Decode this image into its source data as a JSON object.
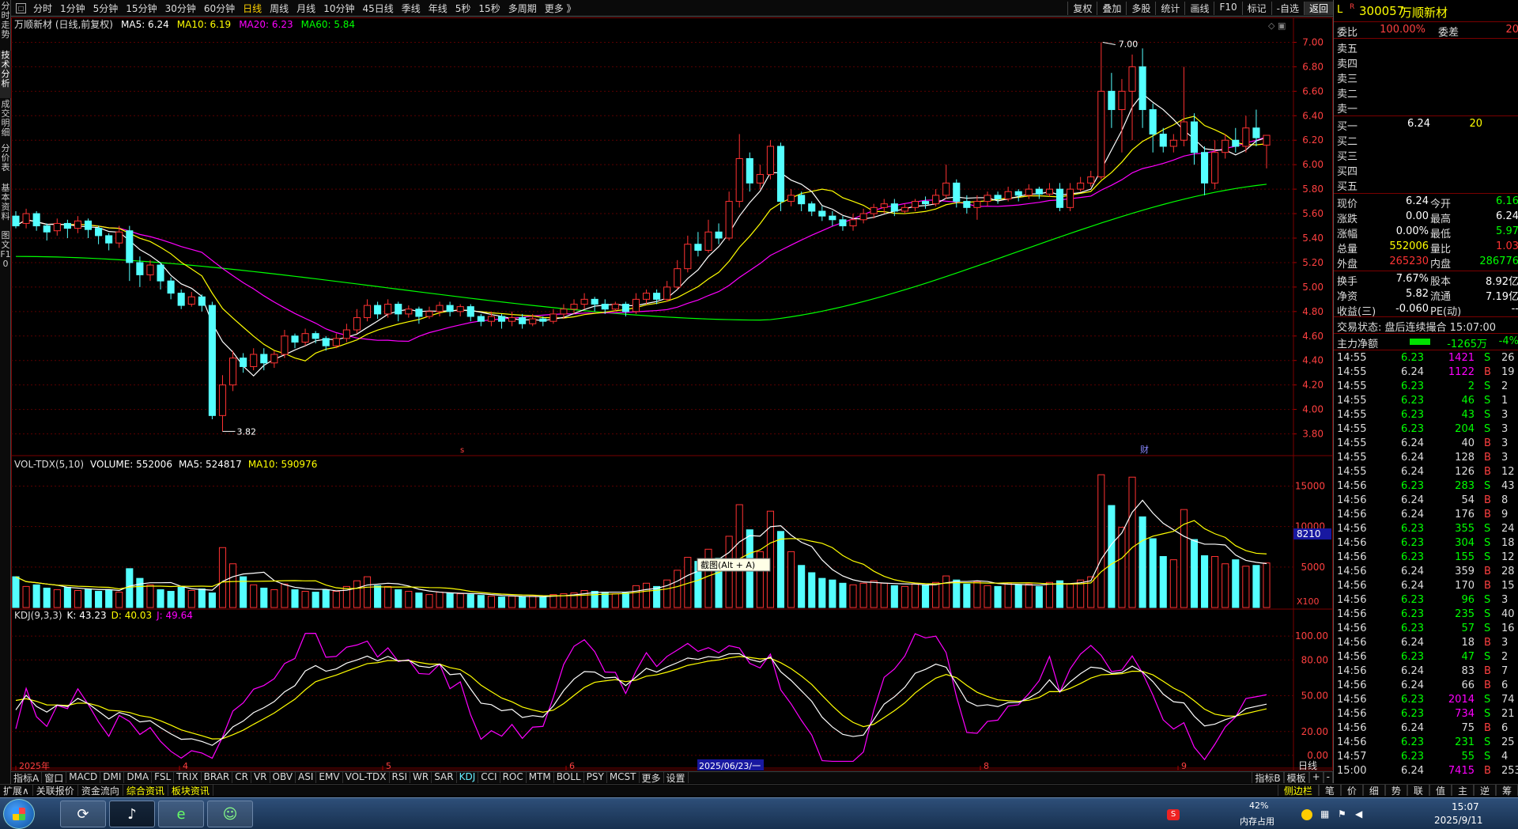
{
  "toolbar": {
    "periods": [
      "分时",
      "1分钟",
      "5分钟",
      "15分钟",
      "30分钟",
      "60分钟",
      "日线",
      "周线",
      "月线",
      "10分钟",
      "45日线",
      "季线",
      "年线",
      "5秒",
      "15秒",
      "多周期",
      "更多 》"
    ],
    "active_period": "日线",
    "right_buttons": [
      "复权",
      "叠加",
      "多股",
      "统计",
      "画线",
      "F10",
      "标记",
      "-自选",
      "返回"
    ],
    "active_right": "返回"
  },
  "side_tabs": [
    "分时走势",
    "技术分析",
    "成交明细",
    "分价表",
    "基本资料",
    "图文F10"
  ],
  "main": {
    "title": "万顺新材 (日线,前复权)",
    "ma": [
      {
        "label": "MA5: 6.24",
        "color": "#ffffff"
      },
      {
        "label": "MA10: 6.19",
        "color": "#ffff00"
      },
      {
        "label": "MA20: 6.23",
        "color": "#ff00ff"
      },
      {
        "label": "MA60: 5.84",
        "color": "#00ff00"
      }
    ],
    "y_ticks": [
      "7.00",
      "6.80",
      "6.60",
      "6.40",
      "6.20",
      "6.00",
      "5.80",
      "5.60",
      "5.40",
      "5.20",
      "5.00",
      "4.80",
      "4.60",
      "4.40",
      "4.20",
      "4.00",
      "3.80"
    ],
    "high_label": "7.00",
    "low_label": "3.82",
    "marker_s": "s",
    "marker_cai": "财"
  },
  "volume": {
    "title": "VOL-TDX(5,10)",
    "vol": "VOLUME: 552006",
    "ma5": "MA5: 524817",
    "ma10": "MA10: 590976",
    "y_ticks": [
      "15000",
      "10000",
      "5000"
    ],
    "badge": "8210",
    "unit": "X100"
  },
  "kdj": {
    "title": "KDJ(9,3,3)",
    "k": "K: 43.23",
    "d": "D: 40.03",
    "j": "J: 49.64",
    "y_ticks": [
      "100.00",
      "80.00",
      "50.00",
      "20.00",
      "0.00"
    ]
  },
  "x_axis": {
    "labels": [
      "2025年",
      "4",
      "5",
      "6",
      "8",
      "9"
    ],
    "cursor_date": "2025/06/23/一",
    "right": "日线"
  },
  "tooltip": "截图(Alt + A)",
  "indicator_tabs": [
    "指标A",
    "窗口",
    "MACD",
    "DMI",
    "DMA",
    "FSL",
    "TRIX",
    "BRAR",
    "CR",
    "VR",
    "OBV",
    "ASI",
    "EMV",
    "VOL-TDX",
    "RSI",
    "WR",
    "SAR",
    "KDJ",
    "CCI",
    "ROC",
    "MTM",
    "BOLL",
    "PSY",
    "MCST",
    "更多",
    "设置"
  ],
  "active_indicator": "KDJ",
  "indicator_right": [
    "指标B",
    "模板",
    "+",
    "-"
  ],
  "bottom_tabs": [
    "扩展∧",
    "关联报价",
    "资金流向",
    "综合资讯",
    "板块资讯"
  ],
  "bottom_right": [
    "侧边栏",
    "笔",
    "价",
    "细",
    "势",
    "联",
    "值",
    "主",
    "逆",
    "筹"
  ],
  "stock": {
    "code": "300057",
    "name": "万顺新材",
    "prefix": "L",
    "superscript": "R",
    "weibi_label": "委比",
    "weibi": "100.00%",
    "weicha_label": "委差",
    "weicha": "20",
    "sells": [
      "卖五",
      "卖四",
      "卖三",
      "卖二",
      "卖一"
    ],
    "buys": [
      {
        "l": "买一",
        "p": "6.24",
        "v": "20"
      },
      {
        "l": "买二",
        "p": "",
        "v": ""
      },
      {
        "l": "买三",
        "p": "",
        "v": ""
      },
      {
        "l": "买四",
        "p": "",
        "v": ""
      },
      {
        "l": "买五",
        "p": "",
        "v": ""
      }
    ],
    "quote": [
      {
        "l": "现价",
        "v": "6.24",
        "vc": "#ffffff",
        "l2": "今开",
        "v2": "6.16",
        "v2c": "#00ff00"
      },
      {
        "l": "涨跌",
        "v": "0.00",
        "vc": "#ffffff",
        "l2": "最高",
        "v2": "6.24",
        "v2c": "#ffffff"
      },
      {
        "l": "涨幅",
        "v": "0.00%",
        "vc": "#ffffff",
        "l2": "最低",
        "v2": "5.97",
        "v2c": "#00ff00"
      },
      {
        "l": "总量",
        "v": "552006",
        "vc": "#ffff00",
        "l2": "量比",
        "v2": "1.03",
        "v2c": "#ff3333"
      },
      {
        "l": "外盘",
        "v": "265230",
        "vc": "#ff3333",
        "l2": "内盘",
        "v2": "286776",
        "v2c": "#00ff00"
      }
    ],
    "fund": [
      {
        "l": "换手",
        "v": "7.67%",
        "l2": "股本",
        "v2": "8.92亿"
      },
      {
        "l": "净资",
        "v": "5.82",
        "l2": "流通",
        "v2": "7.19亿"
      },
      {
        "l": "收益(三)",
        "v": "-0.060",
        "l2": "PE(动)",
        "v2": "--"
      }
    ],
    "status": "交易状态: 盘后连续撮合 15:07:00",
    "flow_label": "主力净额",
    "flow_value": "-1265万",
    "flow_pct": "-4%"
  },
  "ticks": [
    [
      "14:55",
      "6.23",
      "1421",
      "S",
      "26"
    ],
    [
      "14:55",
      "6.24",
      "1122",
      "B",
      "19"
    ],
    [
      "14:55",
      "6.23",
      "2",
      "S",
      "2"
    ],
    [
      "14:55",
      "6.23",
      "46",
      "S",
      "1"
    ],
    [
      "14:55",
      "6.23",
      "43",
      "S",
      "3"
    ],
    [
      "14:55",
      "6.23",
      "204",
      "S",
      "3"
    ],
    [
      "14:55",
      "6.24",
      "40",
      "B",
      "3"
    ],
    [
      "14:55",
      "6.24",
      "128",
      "B",
      "3"
    ],
    [
      "14:55",
      "6.24",
      "126",
      "B",
      "12"
    ],
    [
      "14:56",
      "6.23",
      "283",
      "S",
      "43"
    ],
    [
      "14:56",
      "6.24",
      "54",
      "B",
      "8"
    ],
    [
      "14:56",
      "6.24",
      "176",
      "B",
      "9"
    ],
    [
      "14:56",
      "6.23",
      "355",
      "S",
      "24"
    ],
    [
      "14:56",
      "6.23",
      "304",
      "S",
      "18"
    ],
    [
      "14:56",
      "6.23",
      "155",
      "S",
      "12"
    ],
    [
      "14:56",
      "6.24",
      "359",
      "B",
      "28"
    ],
    [
      "14:56",
      "6.24",
      "170",
      "B",
      "15"
    ],
    [
      "14:56",
      "6.23",
      "96",
      "S",
      "3"
    ],
    [
      "14:56",
      "6.23",
      "235",
      "S",
      "40"
    ],
    [
      "14:56",
      "6.23",
      "57",
      "S",
      "16"
    ],
    [
      "14:56",
      "6.24",
      "18",
      "B",
      "3"
    ],
    [
      "14:56",
      "6.23",
      "47",
      "S",
      "2"
    ],
    [
      "14:56",
      "6.24",
      "83",
      "B",
      "7"
    ],
    [
      "14:56",
      "6.24",
      "66",
      "B",
      "6"
    ],
    [
      "14:56",
      "6.23",
      "2014",
      "S",
      "74"
    ],
    [
      "14:56",
      "6.23",
      "734",
      "S",
      "21"
    ],
    [
      "14:56",
      "6.24",
      "75",
      "B",
      "6"
    ],
    [
      "14:56",
      "6.23",
      "231",
      "S",
      "25"
    ],
    [
      "14:57",
      "6.23",
      "55",
      "S",
      "4"
    ],
    [
      "15:00",
      "6.24",
      "7415",
      "B",
      "253"
    ]
  ],
  "taskbar": {
    "mem_pct": "42%",
    "mem_label": "内存占用",
    "time": "15:07",
    "date": "2025/9/11"
  },
  "colors": {
    "up": "#ff3232",
    "down": "#54ffff",
    "ma5": "#ffffff",
    "ma10": "#ffff00",
    "ma20": "#ff00ff",
    "ma60": "#00ff00"
  },
  "chart_data": {
    "type": "candlestick",
    "candles": [
      [
        5.58,
        5.5,
        5.62,
        5.48
      ],
      [
        5.52,
        5.6,
        5.64,
        5.48
      ],
      [
        5.6,
        5.5,
        5.62,
        5.46
      ],
      [
        5.5,
        5.45,
        5.52,
        5.38
      ],
      [
        5.46,
        5.52,
        5.56,
        5.42
      ],
      [
        5.52,
        5.48,
        5.55,
        5.4
      ],
      [
        5.48,
        5.54,
        5.58,
        5.44
      ],
      [
        5.54,
        5.47,
        5.56,
        5.4
      ],
      [
        5.48,
        5.42,
        5.5,
        5.35
      ],
      [
        5.42,
        5.36,
        5.44,
        5.3
      ],
      [
        5.36,
        5.45,
        5.5,
        5.32
      ],
      [
        5.46,
        5.2,
        5.5,
        5.05
      ],
      [
        5.2,
        5.1,
        5.25,
        5.0
      ],
      [
        5.1,
        5.18,
        5.22,
        5.05
      ],
      [
        5.18,
        5.05,
        5.2,
        4.98
      ],
      [
        5.05,
        4.95,
        5.08,
        4.9
      ],
      [
        4.95,
        4.85,
        4.98,
        4.82
      ],
      [
        4.86,
        4.92,
        4.96,
        4.84
      ],
      [
        4.92,
        4.85,
        4.94,
        4.8
      ],
      [
        4.85,
        3.95,
        4.88,
        3.92
      ],
      [
        3.95,
        4.2,
        4.28,
        3.82
      ],
      [
        4.2,
        4.42,
        4.48,
        4.15
      ],
      [
        4.42,
        4.35,
        4.46,
        4.3
      ],
      [
        4.35,
        4.45,
        4.5,
        4.32
      ],
      [
        4.45,
        4.38,
        4.5,
        4.32
      ],
      [
        4.38,
        4.45,
        4.48,
        4.34
      ],
      [
        4.45,
        4.6,
        4.65,
        4.42
      ],
      [
        4.6,
        4.55,
        4.62,
        4.5
      ],
      [
        4.55,
        4.62,
        4.66,
        4.52
      ],
      [
        4.62,
        4.58,
        4.64,
        4.54
      ],
      [
        4.58,
        4.52,
        4.6,
        4.48
      ],
      [
        4.52,
        4.58,
        4.62,
        4.5
      ],
      [
        4.58,
        4.65,
        4.7,
        4.55
      ],
      [
        4.65,
        4.75,
        4.82,
        4.62
      ],
      [
        4.75,
        4.85,
        4.9,
        4.72
      ],
      [
        4.85,
        4.78,
        4.88,
        4.74
      ],
      [
        4.78,
        4.86,
        4.9,
        4.75
      ],
      [
        4.86,
        4.78,
        4.88,
        4.72
      ],
      [
        4.78,
        4.82,
        4.85,
        4.75
      ],
      [
        4.82,
        4.76,
        4.84,
        4.7
      ],
      [
        4.76,
        4.8,
        4.84,
        4.74
      ],
      [
        4.8,
        4.85,
        4.88,
        4.76
      ],
      [
        4.85,
        4.8,
        4.88,
        4.76
      ],
      [
        4.8,
        4.84,
        4.86,
        4.76
      ],
      [
        4.84,
        4.76,
        4.86,
        4.72
      ],
      [
        4.76,
        4.72,
        4.78,
        4.68
      ],
      [
        4.72,
        4.76,
        4.8,
        4.68
      ],
      [
        4.76,
        4.72,
        4.78,
        4.66
      ],
      [
        4.72,
        4.75,
        4.8,
        4.68
      ],
      [
        4.75,
        4.7,
        4.78,
        4.66
      ],
      [
        4.7,
        4.74,
        4.78,
        4.68
      ],
      [
        4.74,
        4.72,
        4.76,
        4.68
      ],
      [
        4.72,
        4.78,
        4.82,
        4.7
      ],
      [
        4.78,
        4.82,
        4.86,
        4.74
      ],
      [
        4.82,
        4.86,
        4.9,
        4.78
      ],
      [
        4.86,
        4.9,
        4.95,
        4.82
      ],
      [
        4.9,
        4.86,
        4.92,
        4.8
      ],
      [
        4.86,
        4.82,
        4.9,
        4.78
      ],
      [
        4.82,
        4.86,
        4.88,
        4.8
      ],
      [
        4.86,
        4.8,
        4.88,
        4.76
      ],
      [
        4.8,
        4.9,
        4.95,
        4.78
      ],
      [
        4.9,
        4.95,
        4.98,
        4.86
      ],
      [
        4.95,
        4.9,
        4.98,
        4.86
      ],
      [
        4.9,
        5.0,
        5.05,
        4.88
      ],
      [
        5.0,
        5.15,
        5.22,
        4.98
      ],
      [
        5.15,
        5.35,
        5.42,
        5.12
      ],
      [
        5.35,
        5.3,
        5.45,
        5.25
      ],
      [
        5.3,
        5.45,
        5.55,
        5.28
      ],
      [
        5.45,
        5.4,
        5.52,
        5.35
      ],
      [
        5.4,
        5.7,
        5.78,
        5.38
      ],
      [
        5.7,
        6.05,
        6.25,
        5.65
      ],
      [
        6.05,
        5.85,
        6.1,
        5.78
      ],
      [
        5.85,
        5.92,
        6.0,
        5.8
      ],
      [
        5.92,
        6.15,
        6.2,
        5.88
      ],
      [
        6.15,
        5.7,
        6.18,
        5.62
      ],
      [
        5.7,
        5.75,
        5.8,
        5.66
      ],
      [
        5.75,
        5.68,
        5.78,
        5.62
      ],
      [
        5.68,
        5.62,
        5.7,
        5.58
      ],
      [
        5.62,
        5.58,
        5.66,
        5.54
      ],
      [
        5.58,
        5.55,
        5.62,
        5.5
      ],
      [
        5.55,
        5.5,
        5.58,
        5.46
      ],
      [
        5.5,
        5.55,
        5.6,
        5.46
      ],
      [
        5.55,
        5.6,
        5.64,
        5.52
      ],
      [
        5.6,
        5.65,
        5.68,
        5.56
      ],
      [
        5.65,
        5.68,
        5.72,
        5.6
      ],
      [
        5.68,
        5.62,
        5.72,
        5.58
      ],
      [
        5.62,
        5.65,
        5.68,
        5.6
      ],
      [
        5.65,
        5.7,
        5.72,
        5.62
      ],
      [
        5.7,
        5.68,
        5.74,
        5.64
      ],
      [
        5.68,
        5.75,
        5.8,
        5.66
      ],
      [
        5.75,
        5.85,
        6.0,
        5.72
      ],
      [
        5.85,
        5.7,
        5.88,
        5.65
      ],
      [
        5.7,
        5.65,
        5.75,
        5.6
      ],
      [
        5.65,
        5.7,
        5.75,
        5.55
      ],
      [
        5.7,
        5.75,
        5.78,
        5.66
      ],
      [
        5.75,
        5.72,
        5.78,
        5.68
      ],
      [
        5.72,
        5.78,
        5.82,
        5.7
      ],
      [
        5.78,
        5.75,
        5.8,
        5.7
      ],
      [
        5.75,
        5.8,
        5.84,
        5.72
      ],
      [
        5.8,
        5.76,
        5.82,
        5.72
      ],
      [
        5.76,
        5.8,
        5.85,
        5.74
      ],
      [
        5.8,
        5.65,
        5.85,
        5.62
      ],
      [
        5.65,
        5.8,
        5.85,
        5.62
      ],
      [
        5.8,
        5.85,
        5.9,
        5.78
      ],
      [
        5.85,
        5.9,
        5.95,
        5.82
      ],
      [
        5.9,
        6.6,
        7.0,
        5.88
      ],
      [
        6.6,
        6.45,
        6.75,
        6.3
      ],
      [
        6.45,
        6.6,
        6.7,
        6.1
      ],
      [
        6.6,
        6.8,
        6.9,
        6.2
      ],
      [
        6.8,
        6.45,
        6.95,
        6.3
      ],
      [
        6.45,
        6.25,
        6.5,
        6.1
      ],
      [
        6.25,
        6.15,
        6.3,
        6.1
      ],
      [
        6.15,
        6.2,
        6.25,
        6.1
      ],
      [
        6.2,
        6.35,
        6.8,
        6.15
      ],
      [
        6.35,
        6.1,
        6.42,
        6.0
      ],
      [
        6.1,
        5.85,
        6.15,
        5.75
      ],
      [
        5.85,
        6.1,
        6.2,
        5.8
      ],
      [
        6.1,
        6.2,
        6.25,
        6.05
      ],
      [
        6.2,
        6.15,
        6.3,
        6.1
      ],
      [
        6.15,
        6.3,
        6.4,
        6.1
      ],
      [
        6.3,
        6.22,
        6.45,
        6.15
      ],
      [
        6.16,
        6.24,
        6.24,
        5.97
      ]
    ],
    "vol": [
      3800,
      2600,
      2800,
      2400,
      2200,
      2500,
      2100,
      2300,
      2000,
      2200,
      1900,
      4800,
      3600,
      2800,
      2200,
      2000,
      2500,
      2100,
      2300,
      1800,
      7400,
      5400,
      3800,
      2800,
      2400,
      2200,
      2900,
      2200,
      2000,
      1900,
      2200,
      2000,
      2600,
      3300,
      3800,
      2700,
      2600,
      2200,
      2000,
      1800,
      1600,
      1900,
      1800,
      1700,
      1600,
      1500,
      1400,
      1300,
      1400,
      1300,
      1400,
      1300,
      1600,
      1700,
      1800,
      2100,
      2000,
      1900,
      1700,
      1800,
      2700,
      3000,
      2600,
      3400,
      4600,
      6200,
      5700,
      7200,
      6100,
      8800,
      12700,
      9600,
      6900,
      11900,
      9400,
      6900,
      5200,
      4300,
      3600,
      3400,
      3000,
      2800,
      3000,
      3300,
      3000,
      2700,
      2600,
      2900,
      2800,
      3100,
      3900,
      3400,
      2900,
      3200,
      2700,
      2600,
      3000,
      2800,
      2900,
      2600,
      3100,
      3300,
      2900,
      3400,
      3800,
      16400,
      12600,
      9900,
      16100,
      11200,
      8500,
      6300,
      5900,
      12100,
      8400,
      6400,
      6300,
      5400,
      5900,
      5100,
      5200,
      5500
    ],
    "price_ylim": [
      3.7,
      7.1
    ],
    "vol_ylim": [
      0,
      17000
    ],
    "kdj_ylim": [
      -10,
      112
    ],
    "ma60_start": 5.25,
    "ma60_low": 4.73,
    "ma60_end": 5.84
  }
}
